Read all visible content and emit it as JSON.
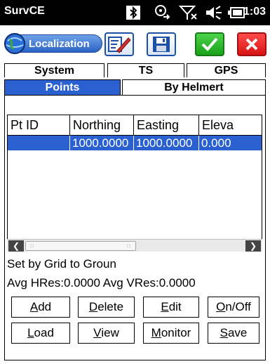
{
  "statusbar": {
    "app_name": "SurvCE",
    "time": "1:03",
    "icons": [
      "bluetooth-icon",
      "connectivity-icon",
      "signal-off-icon",
      "volume-icon",
      "battery-icon"
    ]
  },
  "toolbar": {
    "title": "Localization",
    "buttons": [
      "edit-icon",
      "save-icon",
      "ok-check-icon",
      "cancel-x-icon"
    ]
  },
  "tabs": {
    "row1": [
      {
        "label": "System",
        "selected": false
      },
      {
        "label": "TS",
        "selected": false
      },
      {
        "label": "GPS",
        "selected": false
      }
    ],
    "row2": [
      {
        "label": "Points",
        "selected": true
      },
      {
        "label": "By Helmert",
        "selected": false
      }
    ]
  },
  "table": {
    "columns": [
      "Pt ID",
      "Northing",
      "Easting",
      "Eleva"
    ],
    "rows": [
      [
        "",
        "1000.0000",
        "1000.0000",
        "0.000"
      ]
    ]
  },
  "info": {
    "line1": "Set by Grid to Groun",
    "line2": "Avg HRes:0.0000 Avg VRes:0.0000"
  },
  "buttons": {
    "add": {
      "accel": "A",
      "rest": "dd"
    },
    "delete": {
      "accel": "D",
      "rest": "elete"
    },
    "edit": {
      "accel": "E",
      "rest": "dit"
    },
    "onoff": {
      "accel": "O",
      "rest": "n/Off"
    },
    "load": {
      "accel": "L",
      "rest": "oad"
    },
    "view": {
      "accel": "V",
      "rest": "iew"
    },
    "monitor": {
      "accel": "M",
      "rest": "onitor"
    },
    "save": {
      "accel": "S",
      "rest": "ave"
    }
  },
  "colors": {
    "accent": "#2a60d0",
    "ok": "#1aa21a",
    "cancel": "#d81414"
  }
}
